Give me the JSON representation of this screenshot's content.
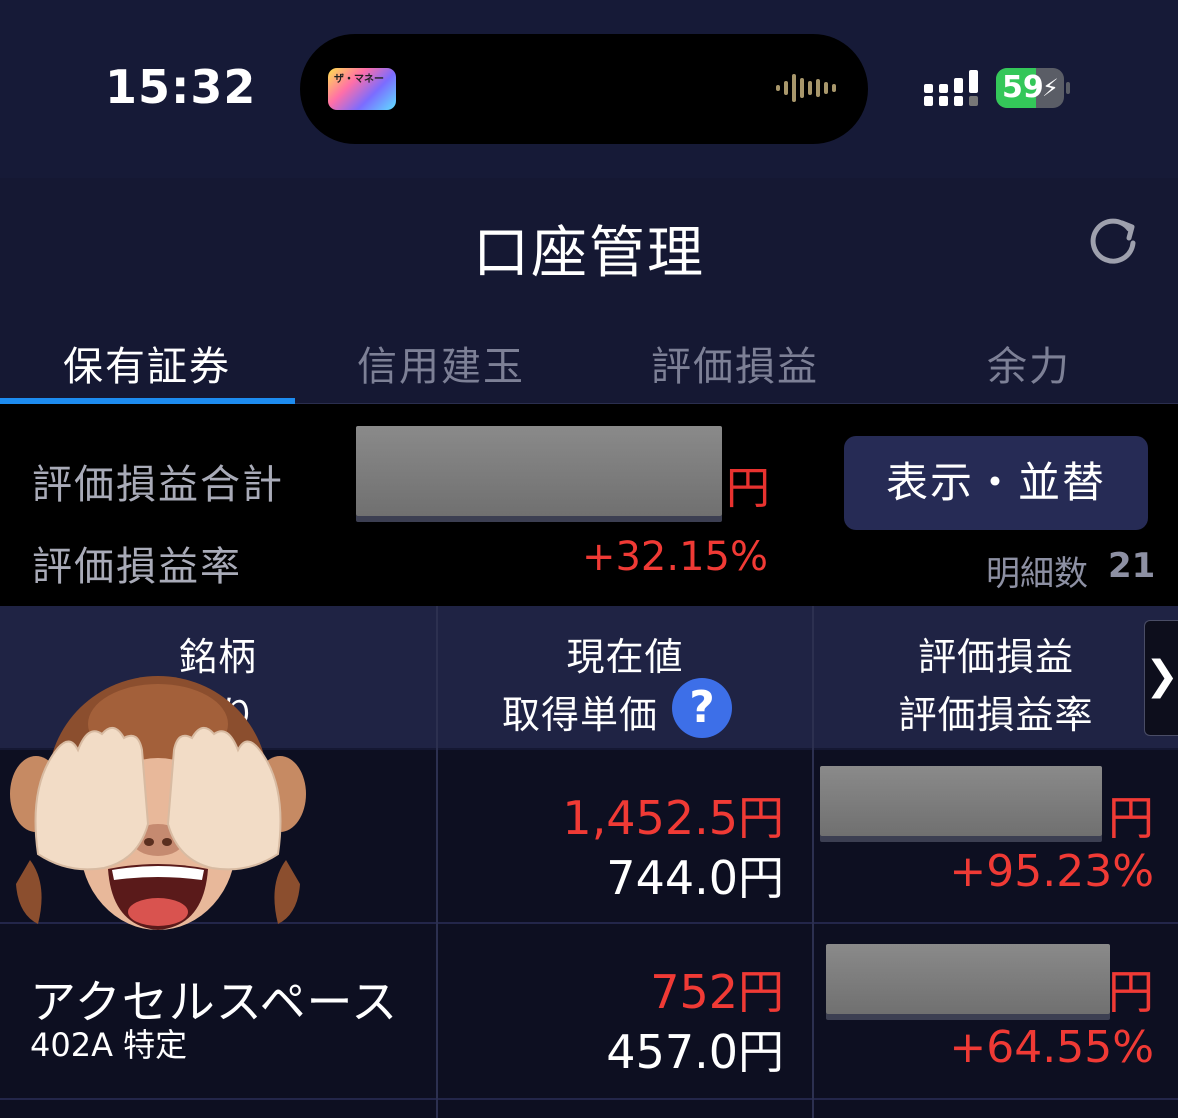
{
  "status_bar": {
    "time": "15:32",
    "island_app_label": "ザ・マネー",
    "battery_percent": 59,
    "battery_text": "59",
    "charging": true
  },
  "header": {
    "title": "口座管理",
    "refresh_icon": "refresh-icon"
  },
  "tabs": [
    {
      "label": "保有証券",
      "active": true
    },
    {
      "label": "信用建玉",
      "active": false
    },
    {
      "label": "評価損益",
      "active": false
    },
    {
      "label": "余力",
      "active": false
    }
  ],
  "summary": {
    "total_label": "評価損益合計",
    "total_unit": "円",
    "rate_label": "評価損益率",
    "rate_value": "+32.15%",
    "sort_button": "表示・並替",
    "count_label": "明細数",
    "count_value": "21"
  },
  "table_header": {
    "col1_line1": "銘柄",
    "col1_line2": "預り",
    "col2_line1": "現在値",
    "col2_line2": "取得単価",
    "help_icon": "help-icon",
    "col3_line1": "評価損益",
    "col3_line2": "評価損益率",
    "next_icon": "chevron-right-icon"
  },
  "rows": [
    {
      "name": "",
      "code": "",
      "current_price": "1,452.5円",
      "acquisition_price": "744.0円",
      "pl_unit": "円",
      "pl_rate": "+95.23%"
    },
    {
      "name": "アクセルスペース",
      "code": "402A 特定",
      "current_price": "752円",
      "acquisition_price": "457.0円",
      "pl_unit": "円",
      "pl_rate": "+64.55%"
    }
  ],
  "colors": {
    "background": "#151833",
    "accent_blue": "#1d8cf0",
    "profit_red": "#f03a35",
    "button_bg": "#262b55"
  }
}
